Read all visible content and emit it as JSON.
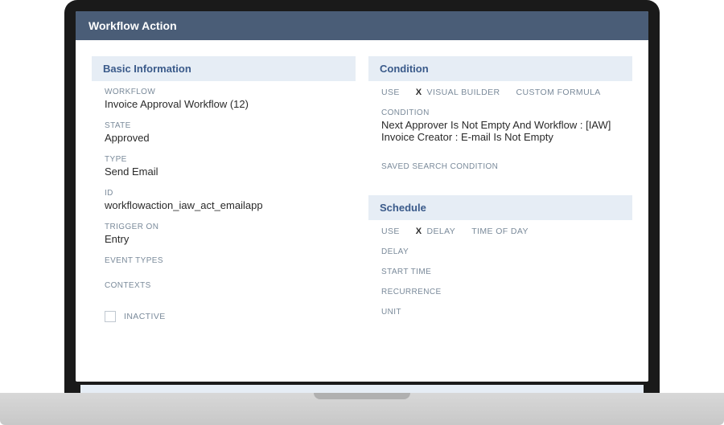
{
  "title": "Workflow Action",
  "basic": {
    "header": "Basic Information",
    "workflow": {
      "label": "WORKFLOW",
      "value": "Invoice Approval Workflow (12)"
    },
    "state": {
      "label": "STATE",
      "value": "Approved"
    },
    "type": {
      "label": "TYPE",
      "value": "Send Email"
    },
    "id": {
      "label": "ID",
      "value": "workflowaction_iaw_act_emailapp"
    },
    "trigger": {
      "label": "TRIGGER ON",
      "value": "Entry"
    },
    "eventTypes": {
      "label": "EVENT TYPES",
      "value": ""
    },
    "contexts": {
      "label": "CONTEXTS",
      "value": ""
    },
    "inactive": {
      "label": "INACTIVE"
    }
  },
  "condition": {
    "header": "Condition",
    "useLabel": "USE",
    "selectedMarker": "X",
    "option1": "VISUAL BUILDER",
    "option2": "CUSTOM FORMULA",
    "conditionField": {
      "label": "CONDITION",
      "value": "Next Approver Is Not Empty And Workflow : [IAW] Invoice Creator : E-mail Is Not Empty"
    },
    "savedSearch": {
      "label": "SAVED SEARCH CONDITION",
      "value": ""
    }
  },
  "schedule": {
    "header": "Schedule",
    "useLabel": "USE",
    "selectedMarker": "X",
    "option1": "DELAY",
    "option2": "TIME OF DAY",
    "delay": {
      "label": "DELAY",
      "value": ""
    },
    "startTime": {
      "label": "START TIME",
      "value": ""
    },
    "recurrence": {
      "label": "RECURRENCE",
      "value": ""
    },
    "unit": {
      "label": "UNIT",
      "value": ""
    }
  }
}
